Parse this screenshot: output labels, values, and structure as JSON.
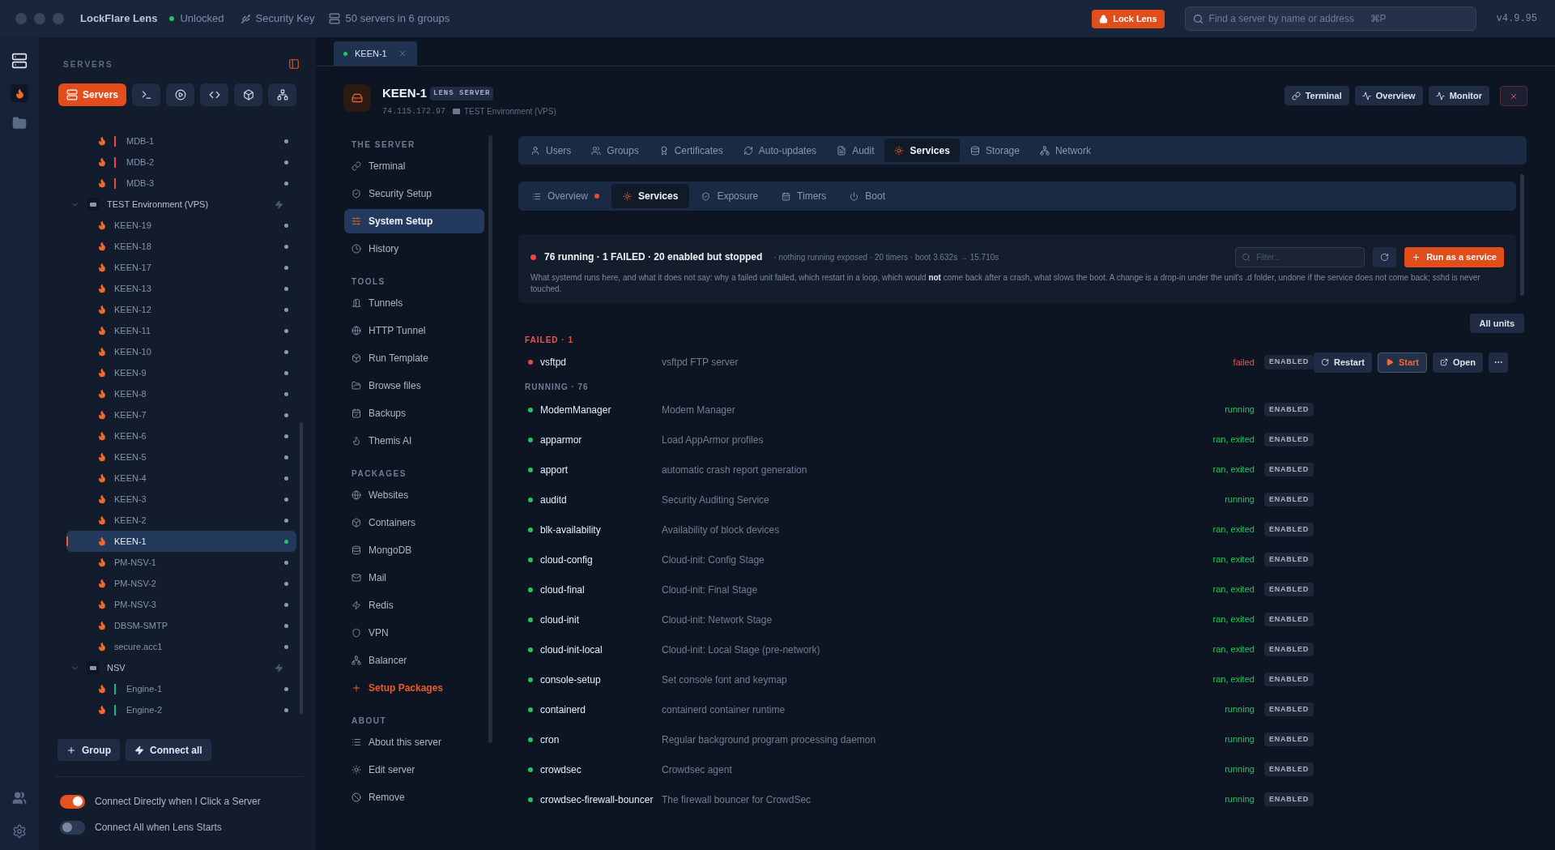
{
  "titlebar": {
    "app": "LockFlare Lens",
    "lock_state": "Unlocked",
    "unlocked": true,
    "key": "Security Key",
    "servers_count": "50 servers in 6 groups",
    "lock_button": "Lock Lens",
    "search": {
      "placeholder": "Find a server by name or address",
      "shortcut": "⌘P"
    },
    "version": "v4.9.95"
  },
  "sidebar": {
    "title": "SERVERS",
    "toolbar": [
      {
        "label": "Servers",
        "selected": true
      },
      {
        "selected": false
      },
      {
        "selected": false
      },
      {
        "selected": false
      },
      {
        "selected": false
      },
      {
        "selected": false
      }
    ],
    "tree": [
      {
        "name": "MDB-1",
        "color": "#ef4444",
        "online": false,
        "selected": false
      },
      {
        "name": "MDB-2",
        "color": "#ef4444",
        "online": false,
        "selected": false
      },
      {
        "name": "MDB-3",
        "color": "#ef4444",
        "online": false,
        "selected": false
      },
      {
        "name": "TEST Environment (VPS)",
        "expanded": true,
        "children": [
          {
            "name": "KEEN-19",
            "online": false,
            "selected": false
          },
          {
            "name": "KEEN-18",
            "online": false,
            "selected": false
          },
          {
            "name": "KEEN-17",
            "online": false,
            "selected": false
          },
          {
            "name": "KEEN-13",
            "online": false,
            "selected": false
          },
          {
            "name": "KEEN-12",
            "online": false,
            "selected": false
          },
          {
            "name": "KEEN-11",
            "online": false,
            "selected": false
          },
          {
            "name": "KEEN-10",
            "online": false,
            "selected": false
          },
          {
            "name": "KEEN-9",
            "online": false,
            "selected": false
          },
          {
            "name": "KEEN-8",
            "online": false,
            "selected": false
          },
          {
            "name": "KEEN-7",
            "online": false,
            "selected": false
          },
          {
            "name": "KEEN-6",
            "online": false,
            "selected": false
          },
          {
            "name": "KEEN-5",
            "online": false,
            "selected": false
          },
          {
            "name": "KEEN-4",
            "online": false,
            "selected": false
          },
          {
            "name": "KEEN-3",
            "online": false,
            "selected": false
          },
          {
            "name": "KEEN-2",
            "online": false,
            "selected": false
          },
          {
            "name": "KEEN-1",
            "online": true,
            "selected": true
          },
          {
            "name": "PM-NSV-1",
            "online": false,
            "selected": false
          },
          {
            "name": "PM-NSV-2",
            "online": false,
            "selected": false
          },
          {
            "name": "PM-NSV-3",
            "online": false,
            "selected": false
          },
          {
            "name": "DBSM-SMTP",
            "online": false,
            "selected": false
          },
          {
            "name": "secure.acc1",
            "online": false,
            "selected": false
          }
        ]
      },
      {
        "name": "NSV",
        "expanded": true,
        "children": [
          {
            "name": "Engine-1",
            "color": "#10b981",
            "online": false,
            "selected": false
          },
          {
            "name": "Engine-2",
            "color": "#10b981",
            "online": false,
            "selected": false
          }
        ]
      }
    ],
    "buttons": [
      "Group",
      "Connect all"
    ],
    "toggles": [
      {
        "label": "Connect Directly when I Click a Server",
        "on": true
      },
      {
        "label": "Connect All when Lens Starts",
        "on": false
      }
    ]
  },
  "tab": {
    "label": "KEEN-1",
    "online": true
  },
  "server": {
    "name": "KEEN-1",
    "badge": "LENS SERVER",
    "address": "74.115.172.97",
    "group": "TEST Environment (VPS)",
    "actions": [
      "Terminal",
      "Overview",
      "Monitor"
    ]
  },
  "nav": [
    {
      "title": "THE SERVER",
      "items": [
        {
          "label": "Terminal",
          "selected": false
        },
        {
          "label": "Security Setup",
          "selected": false
        },
        {
          "label": "System Setup",
          "selected": true
        },
        {
          "label": "History",
          "selected": false
        }
      ]
    },
    {
      "title": "TOOLS",
      "items": [
        {
          "label": "Tunnels",
          "selected": false
        },
        {
          "label": "HTTP Tunnel",
          "selected": false
        },
        {
          "label": "Run Template",
          "selected": false
        },
        {
          "label": "Browse files",
          "selected": false
        },
        {
          "label": "Backups",
          "selected": false
        },
        {
          "label": "Themis AI",
          "selected": false
        }
      ]
    },
    {
      "title": "PACKAGES",
      "items": [
        {
          "label": "Websites",
          "selected": false
        },
        {
          "label": "Containers",
          "selected": false
        },
        {
          "label": "MongoDB",
          "selected": false
        },
        {
          "label": "Mail",
          "selected": false
        },
        {
          "label": "Redis",
          "selected": false
        },
        {
          "label": "VPN",
          "selected": false
        },
        {
          "label": "Balancer",
          "selected": false
        },
        {
          "label": "Setup Packages",
          "selected": false,
          "kind": "accent"
        }
      ]
    },
    {
      "title": "ABOUT",
      "items": [
        {
          "label": "About this server",
          "selected": false
        },
        {
          "label": "Edit server",
          "selected": false
        },
        {
          "label": "Remove",
          "selected": false
        }
      ]
    }
  ],
  "tabs": [
    {
      "label": "Users",
      "selected": false
    },
    {
      "label": "Groups",
      "selected": false
    },
    {
      "label": "Certificates",
      "selected": false
    },
    {
      "label": "Auto-updates",
      "selected": false
    },
    {
      "label": "Audit",
      "selected": false
    },
    {
      "label": "Services",
      "selected": true
    },
    {
      "label": "Storage",
      "selected": false
    },
    {
      "label": "Network",
      "selected": false
    }
  ],
  "subtabs": [
    {
      "label": "Overview",
      "selected": false,
      "alert": true
    },
    {
      "label": "Services",
      "selected": true,
      "alert": false
    },
    {
      "label": "Exposure",
      "selected": false,
      "alert": false
    },
    {
      "label": "Timers",
      "selected": false,
      "alert": false
    },
    {
      "label": "Boot",
      "selected": false,
      "alert": false
    }
  ],
  "summary": {
    "failing": true,
    "headline": "76 running · 1 FAILED · 20 enabled but stopped",
    "meta": "· nothing running exposed · 20 timers · boot 3.632s → 15.710s",
    "description": "What systemd runs here, and what it does not say: why a failed unit failed, which restart in a loop, which would **not** come back after a crash, what slows the boot. A change is a drop-in under the unit's .d folder, undone if the service does not come back; sshd is never touched.",
    "filter_placeholder": "Filter...",
    "run_button": "Run as a service",
    "all_units": "All units"
  },
  "sections": [
    {
      "title": "FAILED · 1",
      "kind": "failed",
      "units": [
        {
          "name": "vsftpd",
          "description": "vsftpd FTP server",
          "status": "failed",
          "kind": "failed",
          "badge": "ENABLED",
          "actions": [
            "Restart",
            "Start",
            "Open"
          ]
        }
      ]
    },
    {
      "title": "RUNNING · 76",
      "kind": "running",
      "units": [
        {
          "name": "ModemManager",
          "description": "Modem Manager",
          "status": "running",
          "kind": "ok",
          "badge": "ENABLED"
        },
        {
          "name": "apparmor",
          "description": "Load AppArmor profiles",
          "status": "ran, exited",
          "kind": "ok",
          "badge": "ENABLED"
        },
        {
          "name": "apport",
          "description": "automatic crash report generation",
          "status": "ran, exited",
          "kind": "ok",
          "badge": "ENABLED"
        },
        {
          "name": "auditd",
          "description": "Security Auditing Service",
          "status": "running",
          "kind": "ok",
          "badge": "ENABLED"
        },
        {
          "name": "blk-availability",
          "description": "Availability of block devices",
          "status": "ran, exited",
          "kind": "ok",
          "badge": "ENABLED"
        },
        {
          "name": "cloud-config",
          "description": "Cloud-init: Config Stage",
          "status": "ran, exited",
          "kind": "ok",
          "badge": "ENABLED"
        },
        {
          "name": "cloud-final",
          "description": "Cloud-init: Final Stage",
          "status": "ran, exited",
          "kind": "ok",
          "badge": "ENABLED"
        },
        {
          "name": "cloud-init",
          "description": "Cloud-init: Network Stage",
          "status": "ran, exited",
          "kind": "ok",
          "badge": "ENABLED"
        },
        {
          "name": "cloud-init-local",
          "description": "Cloud-init: Local Stage (pre-network)",
          "status": "ran, exited",
          "kind": "ok",
          "badge": "ENABLED"
        },
        {
          "name": "console-setup",
          "description": "Set console font and keymap",
          "status": "ran, exited",
          "kind": "ok",
          "badge": "ENABLED"
        },
        {
          "name": "containerd",
          "description": "containerd container runtime",
          "status": "running",
          "kind": "ok",
          "badge": "ENABLED"
        },
        {
          "name": "cron",
          "description": "Regular background program processing daemon",
          "status": "running",
          "kind": "ok",
          "badge": "ENABLED"
        },
        {
          "name": "crowdsec",
          "description": "Crowdsec agent",
          "status": "running",
          "kind": "ok",
          "badge": "ENABLED"
        },
        {
          "name": "crowdsec-firewall-bouncer",
          "description": "The firewall bouncer for CrowdSec",
          "status": "running",
          "kind": "ok",
          "badge": "ENABLED"
        }
      ]
    }
  ]
}
